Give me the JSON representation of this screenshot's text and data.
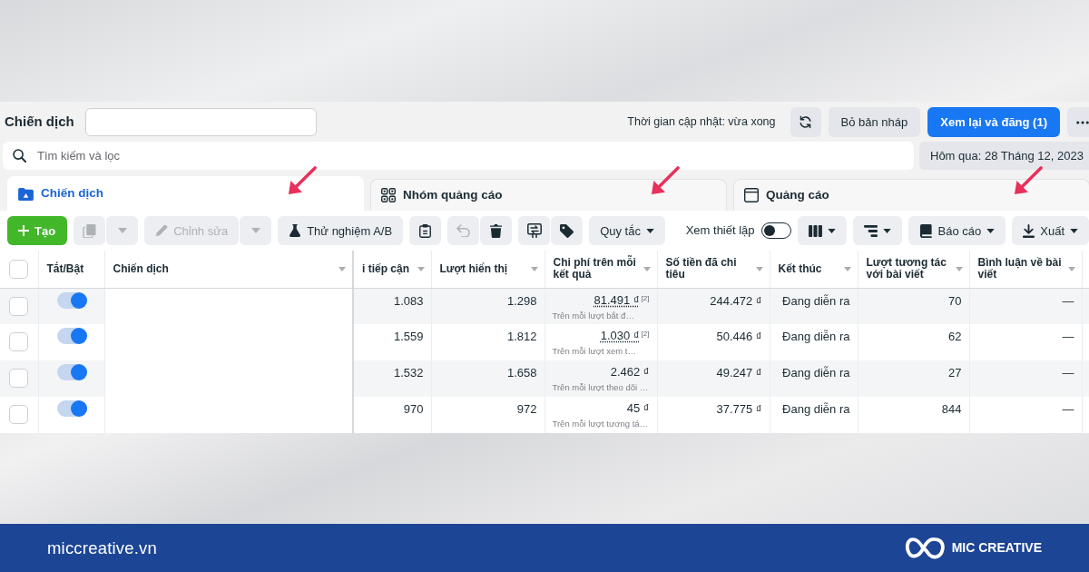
{
  "header": {
    "title": "Chiến dịch",
    "updated": "Thời gian cập nhật: vừa xong",
    "discard_label": "Bỏ bản nháp",
    "publish_label": "Xem lại và đăng (1)"
  },
  "search": {
    "placeholder": "Tìm kiếm và lọc"
  },
  "date_range": {
    "label": "Hôm qua: 28 Tháng 12, 2023"
  },
  "tabs": [
    {
      "label": "Chiến dịch",
      "selected": true,
      "marked": true
    },
    {
      "label": "Nhóm quảng cáo",
      "selected": false,
      "marked": true
    },
    {
      "label": "Quảng cáo",
      "selected": false,
      "marked": true
    }
  ],
  "toolbar": {
    "left": [
      {
        "buttons": [
          {
            "kind": "create",
            "label": "Tạo",
            "disabled": false
          }
        ]
      },
      {
        "buttons": [
          {
            "kind": "duplicate",
            "disabled": true
          },
          {
            "kind": "caret",
            "disabled": true
          }
        ]
      },
      {
        "buttons": [
          {
            "kind": "edit",
            "label": "Chỉnh sửa",
            "disabled": true
          },
          {
            "kind": "caret",
            "disabled": true
          }
        ]
      },
      {
        "buttons": [
          {
            "kind": "abtest",
            "label": "Thử nghiệm A/B",
            "disabled": false
          }
        ]
      },
      {
        "buttons": [
          {
            "kind": "clipboard",
            "disabled": false
          }
        ]
      },
      {
        "buttons": [
          {
            "kind": "undo",
            "disabled": true
          },
          {
            "kind": "delete",
            "disabled": false
          }
        ]
      },
      {
        "buttons": [
          {
            "kind": "move",
            "disabled": false
          },
          {
            "kind": "tag",
            "disabled": false
          }
        ]
      },
      {
        "buttons": [
          {
            "kind": "rules",
            "label": "Quy tắc",
            "dropdown": true,
            "disabled": false
          }
        ]
      }
    ],
    "right": [
      {
        "kind": "view_toggle",
        "label": "Xem thiết lập",
        "on": false
      },
      {
        "kind": "columns",
        "dropdown": true
      },
      {
        "kind": "breakdown",
        "dropdown": true
      },
      {
        "kind": "reports",
        "label": "Báo cáo",
        "dropdown": true
      },
      {
        "kind": "export",
        "label": "Xuất",
        "dropdown": true
      }
    ]
  },
  "table": {
    "select_all": {
      "checked": false
    },
    "columns": [
      {
        "kind": "toggle",
        "label": "Tắt/Bật",
        "sortable": false
      },
      {
        "kind": "name",
        "label": "Chiến dịch",
        "sortable": true
      },
      {
        "kind": "number",
        "label": "i tiếp cận",
        "sortable": true
      },
      {
        "kind": "number",
        "label": "Lượt hiển thị",
        "sortable": true
      },
      {
        "kind": "cost",
        "label": "Chi phí trên mỗi kết quả",
        "sortable": true
      },
      {
        "kind": "number",
        "label": "Số tiền đã chi tiêu",
        "sortable": true
      },
      {
        "kind": "text",
        "label": "Kết thúc",
        "sortable": true
      },
      {
        "kind": "number",
        "label": "Lượt tương tác với bài viết",
        "sortable": true
      },
      {
        "kind": "number",
        "label": "Bình luận về bài viết",
        "sortable": true
      }
    ],
    "rows": [
      {
        "checked": false,
        "on": true,
        "metrics": [
          "1.083",
          "1.298",
          {
            "value": "81.491 ₫",
            "note": "[2]",
            "detail": "Trên mỗi lượt bắt đ…"
          },
          "244.472 ₫",
          "Đang diễn ra",
          "70",
          "—"
        ]
      },
      {
        "checked": false,
        "on": true,
        "metrics": [
          "1.559",
          "1.812",
          {
            "value": "1.030 ₫",
            "note": "[2]",
            "detail": "Trên mỗi lượt xem t…"
          },
          "50.446 ₫",
          "Đang diễn ra",
          "62",
          "—"
        ]
      },
      {
        "checked": false,
        "on": true,
        "metrics": [
          "1.532",
          "1.658",
          {
            "value": "2.462 ₫",
            "detail": "Trên mỗi lượt theo dõi …"
          },
          "49.247 ₫",
          "Đang diễn ra",
          "27",
          "—"
        ]
      },
      {
        "checked": false,
        "on": true,
        "metrics": [
          "970",
          "972",
          {
            "value": "45 ₫",
            "detail": "Trên mỗi lượt tương tá…"
          },
          "37.775 ₫",
          "Đang diễn ra",
          "844",
          "—"
        ]
      }
    ]
  },
  "footer": {
    "site": "miccreative.vn",
    "brand": "MIC CREATIVE"
  }
}
